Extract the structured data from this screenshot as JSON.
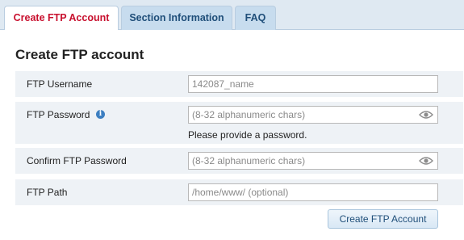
{
  "tabs": [
    {
      "label": "Create FTP Account",
      "active": true
    },
    {
      "label": "Section Information",
      "active": false
    },
    {
      "label": "FAQ",
      "active": false
    }
  ],
  "form": {
    "title": "Create FTP account",
    "username": {
      "label": "FTP Username",
      "value": "",
      "placeholder": "142087_name"
    },
    "password": {
      "label": "FTP Password",
      "value": "",
      "placeholder": "(8-32 alphanumeric chars)",
      "hint": "Please provide a password.",
      "info_icon": "info-icon",
      "toggle_icon": "eye-icon"
    },
    "confirm": {
      "label": "Confirm FTP Password",
      "value": "",
      "placeholder": "(8-32 alphanumeric chars)",
      "toggle_icon": "eye-icon"
    },
    "path": {
      "label": "FTP Path",
      "value": "",
      "placeholder": "/home/www/ (optional)"
    },
    "submit_label": "Create FTP Account"
  },
  "colors": {
    "active_tab_text": "#c8102e",
    "tab_text": "#1f4e79",
    "row_background": "#eef2f6",
    "info_icon": "#3d7fc1"
  }
}
